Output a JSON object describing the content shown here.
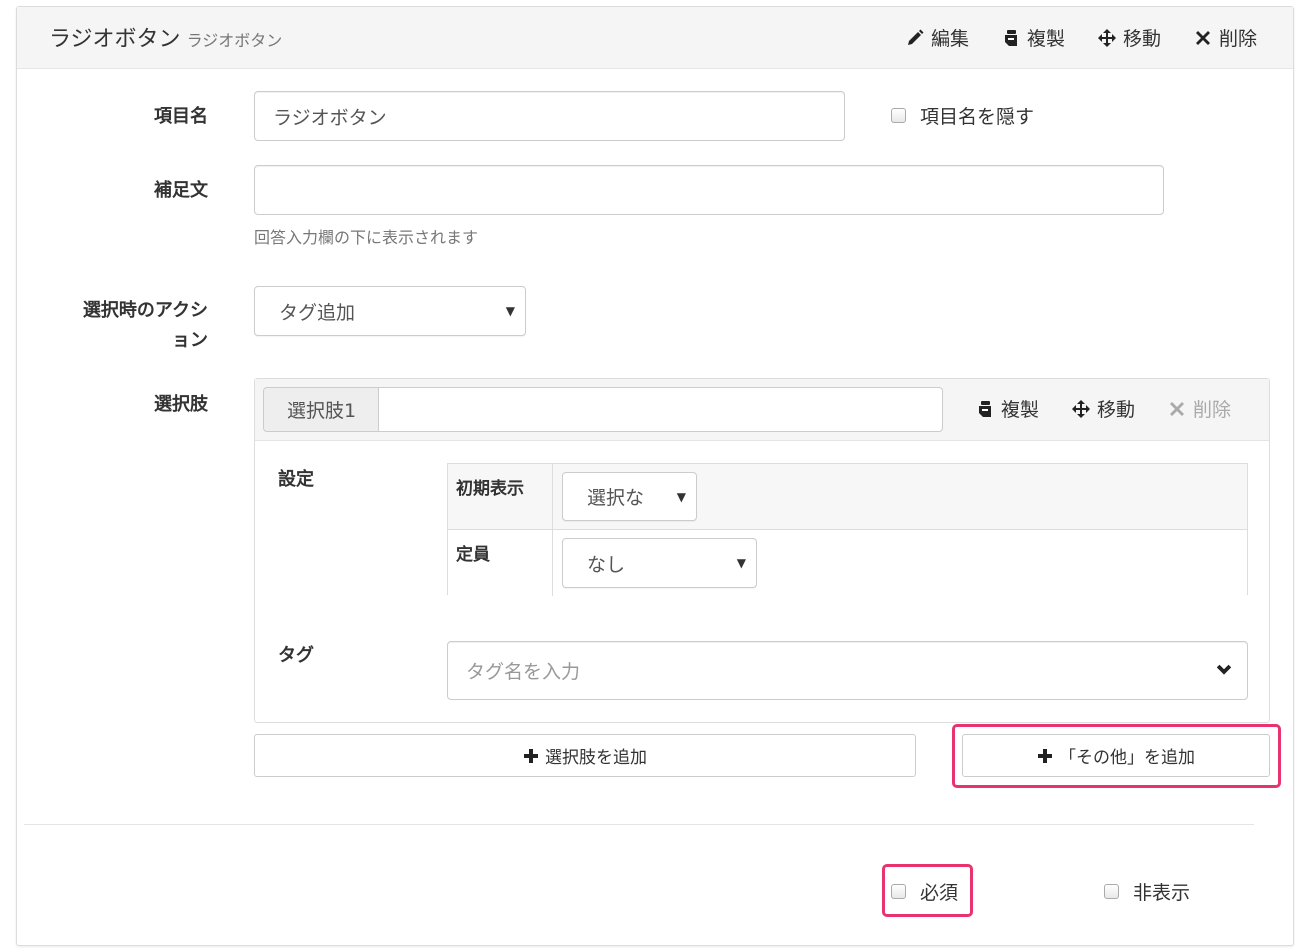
{
  "header": {
    "title": "ラジオボタン",
    "subtitle": "ラジオボタン",
    "actions": {
      "edit": "編集",
      "duplicate": "複製",
      "move": "移動",
      "delete": "削除"
    }
  },
  "fields": {
    "item_name": {
      "label": "項目名",
      "value": "ラジオボタン",
      "hide_label": "項目名を隠す"
    },
    "supplement": {
      "label": "補足文",
      "value": "",
      "help": "回答入力欄の下に表示されます"
    },
    "action": {
      "label_line1": "選択時のアクシ",
      "label_line2": "ョン",
      "selected": "タグ追加"
    }
  },
  "choices": {
    "label": "選択肢",
    "item": {
      "prefix": "選択肢1",
      "value": "",
      "actions": {
        "duplicate": "複製",
        "move": "移動",
        "delete": "削除"
      },
      "settings_label": "設定",
      "settings": [
        {
          "name": "初期表示",
          "selected": "選択な"
        },
        {
          "name": "定員",
          "selected": "なし"
        }
      ],
      "tag_label": "タグ",
      "tag_placeholder": "タグ名を入力"
    },
    "add_choice": "選択肢を追加",
    "add_other": "「その他」を追加"
  },
  "footer": {
    "required": "必須",
    "hidden": "非表示"
  },
  "colors": {
    "highlight": "#e8336f"
  },
  "icons": [
    "pencil-icon",
    "duplicate-icon",
    "move-icon",
    "delete-icon",
    "plus-icon",
    "caret-down-icon",
    "chevron-down-icon"
  ]
}
